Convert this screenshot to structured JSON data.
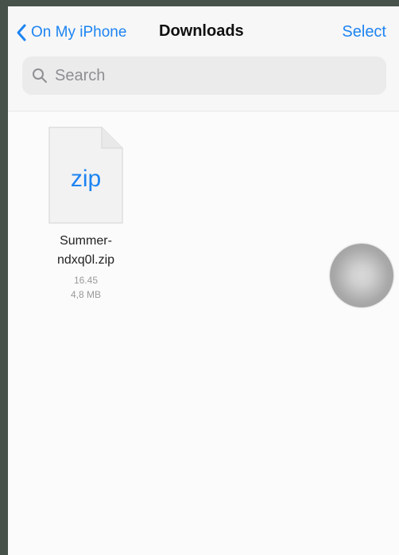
{
  "nav": {
    "back_label": "On My iPhone",
    "title": "Downloads",
    "select_label": "Select"
  },
  "search": {
    "placeholder": "Search",
    "value": ""
  },
  "files": [
    {
      "type_label": "zip",
      "name_line1": "Summer-",
      "name_line2": "ndxq0l.zip",
      "time": "16.45",
      "size": "4,8 MB"
    }
  ],
  "colors": {
    "accent": "#1d84f2",
    "background": "#47524a"
  },
  "icons": {
    "back": "chevron-left-icon",
    "search": "magnifying-glass-icon",
    "file": "zip-document-icon",
    "assistive_touch": "assistive-touch-icon"
  }
}
